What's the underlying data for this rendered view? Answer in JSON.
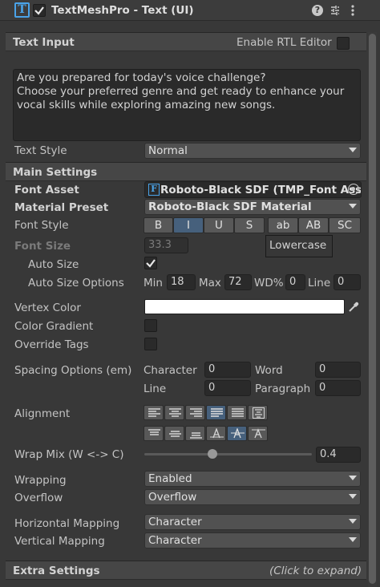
{
  "header": {
    "title": "TextMeshPro - Text (UI)",
    "enabled": true,
    "icons": [
      "help-icon",
      "preset-icon",
      "kebab-menu-icon"
    ]
  },
  "text_input": {
    "section_label": "Text Input",
    "rtl_label": "Enable RTL Editor",
    "rtl_enabled": false,
    "text_lines": [
      "Are you prepared for today's voice challenge?",
      "Choose your preferred genre and get ready to enhance your",
      "vocal skills while exploring amazing new songs."
    ],
    "text_style_label": "Text Style",
    "text_style_value": "Normal"
  },
  "main": {
    "section_label": "Main Settings",
    "font_asset_label": "Font Asset",
    "font_asset_value": "Roboto-Black SDF (TMP_Font Ass",
    "material_preset_label": "Material Preset",
    "material_preset_value": "Roboto-Black SDF Material",
    "font_style_label": "Font Style",
    "font_style_buttons": [
      {
        "label": "B",
        "active": false
      },
      {
        "label": "I",
        "active": true
      },
      {
        "label": "U",
        "active": false
      },
      {
        "label": "S",
        "active": false
      },
      {
        "label": "ab",
        "active": false
      },
      {
        "label": "AB",
        "active": false
      },
      {
        "label": "SC",
        "active": false
      }
    ],
    "tooltip": "Lowercase",
    "font_size_label": "Font Size",
    "font_size_value": "33.3",
    "auto_size_label": "Auto Size",
    "auto_size_checked": true,
    "auto_size_options_label": "Auto Size Options",
    "min_label": "Min",
    "min_value": "18",
    "max_label": "Max",
    "max_value": "72",
    "wd_label": "WD%",
    "wd_value": "0",
    "line_label": "Line",
    "line_value": "0",
    "vertex_color_label": "Vertex Color",
    "vertex_color": "#ffffff",
    "color_gradient_label": "Color Gradient",
    "override_tags_label": "Override Tags",
    "spacing_label": "Spacing Options (em)",
    "character_label": "Character",
    "character_value": "0",
    "word_label": "Word",
    "word_value": "0",
    "line_spacing_label": "Line",
    "line_spacing_value": "0",
    "paragraph_label": "Paragraph",
    "paragraph_value": "0",
    "alignment_label": "Alignment",
    "horizontal_alignment_icons": [
      "align-left-icon",
      "align-center-icon",
      "align-right-icon",
      "align-justified-icon",
      "align-flush-icon",
      "align-geometry-center-icon"
    ],
    "horizontal_active": "align-justified-icon",
    "vertical_alignment_icons": [
      "align-top-icon",
      "align-middle-icon",
      "align-bottom-icon",
      "align-baseline-icon",
      "align-midline-icon",
      "align-capline-icon"
    ],
    "vertical_active": "align-midline-icon",
    "wrap_mix_label": "Wrap Mix (W <-> C)",
    "wrap_mix_value": "0.4",
    "wrapping_label": "Wrapping",
    "wrapping_value": "Enabled",
    "overflow_label": "Overflow",
    "overflow_value": "Overflow",
    "horizontal_mapping_label": "Horizontal Mapping",
    "horizontal_mapping_value": "Character",
    "vertical_mapping_label": "Vertical Mapping",
    "vertical_mapping_value": "Character"
  },
  "extra": {
    "section_label": "Extra Settings",
    "hint": "(Click to expand)"
  },
  "colors": {
    "background": "#383838",
    "section": "#464646",
    "field": "#2a2a2a",
    "active_button": "#46607c"
  }
}
